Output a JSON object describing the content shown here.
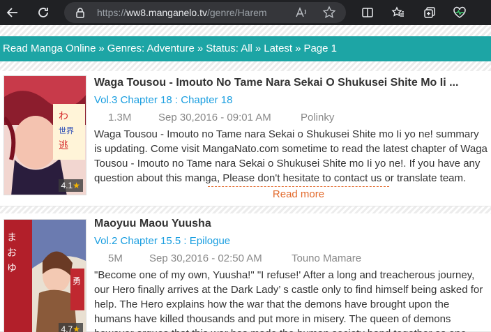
{
  "browser": {
    "url_prefix": "https://",
    "url_host": "ww8.manganelo.tv",
    "url_path": "/genre/Harem"
  },
  "breadcrumb": [
    "Read Manga Online",
    "»",
    "Genres: Adventure",
    "»",
    "Status: All",
    "»",
    "Latest",
    "»",
    "Page 1"
  ],
  "items": [
    {
      "title": "Waga Tousou - Imouto No Tame Nara Sekai O Shukusei Shite Mo Ii ...",
      "chapter": "Vol.3 Chapter 18 : Chapter 18",
      "views": "1.3M",
      "date": "Sep 30,2016 - 09:01 AM",
      "author": "Polinky",
      "rating": "4.1",
      "summary": "Waga Tousou - Imouto no Tame nara Sekai o Shukusei Shite mo Ii yo ne! summary is updating. Come visit MangaNato.com sometime to read the latest chapter of Waga Tousou - Imouto no Tame nara Sekai o Shukusei Shite mo Ii yo ne!. If you have any question about this manga, Please don't hesitate to contact us or translate team. Hope you enjoy it.",
      "read_more": "Read more"
    },
    {
      "title": "Maoyuu Maou Yuusha",
      "chapter": "Vol.2 Chapter 15.5 : Epilogue",
      "views": "5M",
      "date": "Sep 30,2016 - 02:50 AM",
      "author": "Touno Mamare",
      "rating": "4.7",
      "summary": "\"Become one of my own, Yuusha!\" \"I refuse!' After a long and treacherous journey, our Hero finally arrives at the Dark Lady’ s castle only to find himself being asked for help. The Hero explains how the war that the demons have brought upon the humans have killed thousands and put more in misery. The queen of demons however argues that this war has made the human society band together as one"
    }
  ]
}
